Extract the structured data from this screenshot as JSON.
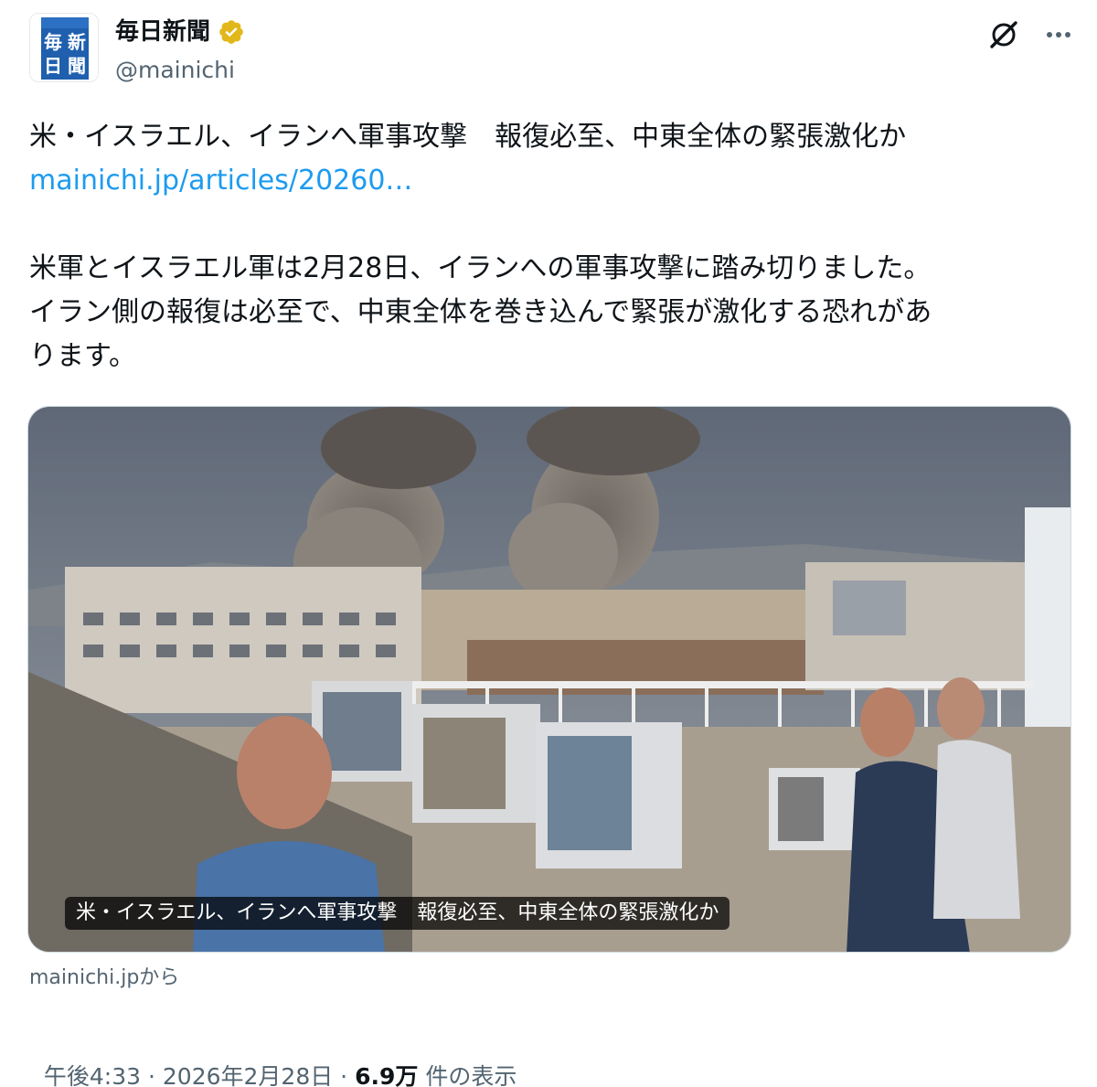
{
  "account": {
    "avatar_chars": [
      "新",
      "毎",
      "聞",
      "日"
    ],
    "display_name": "毎日新聞",
    "handle": "@mainichi",
    "verified_icon": "verified-badge-gold"
  },
  "header_actions": {
    "grok_icon": "grok-icon",
    "more_icon": "more-icon"
  },
  "tweet": {
    "headline": "米・イスラエル、イランへ軍事攻撃　報復必至、中東全体の緊張激化か",
    "link": "mainichi.jp/articles/20260…",
    "body_line1": "米軍とイスラエル軍は2月28日、イランへの軍事攻撃に踏み切りました。",
    "body_line2": "イラン側の報復は必至で、中東全体を巻き込んで緊張が激化する恐れがあ",
    "body_line3": "ります。"
  },
  "card": {
    "caption": "米・イスラエル、イランへ軍事攻撃　報復必至、中東全体の緊張激化か",
    "source": "mainichi.jpから"
  },
  "meta": {
    "time": "午後4:33",
    "sep1": " · ",
    "date": "2026年2月28日",
    "sep2": " · ",
    "views": "6.9万",
    "views_suffix": " 件の表示"
  },
  "colors": {
    "link": "#1d9bf0",
    "secondary_text": "#536471",
    "verified": "#e2b719"
  }
}
